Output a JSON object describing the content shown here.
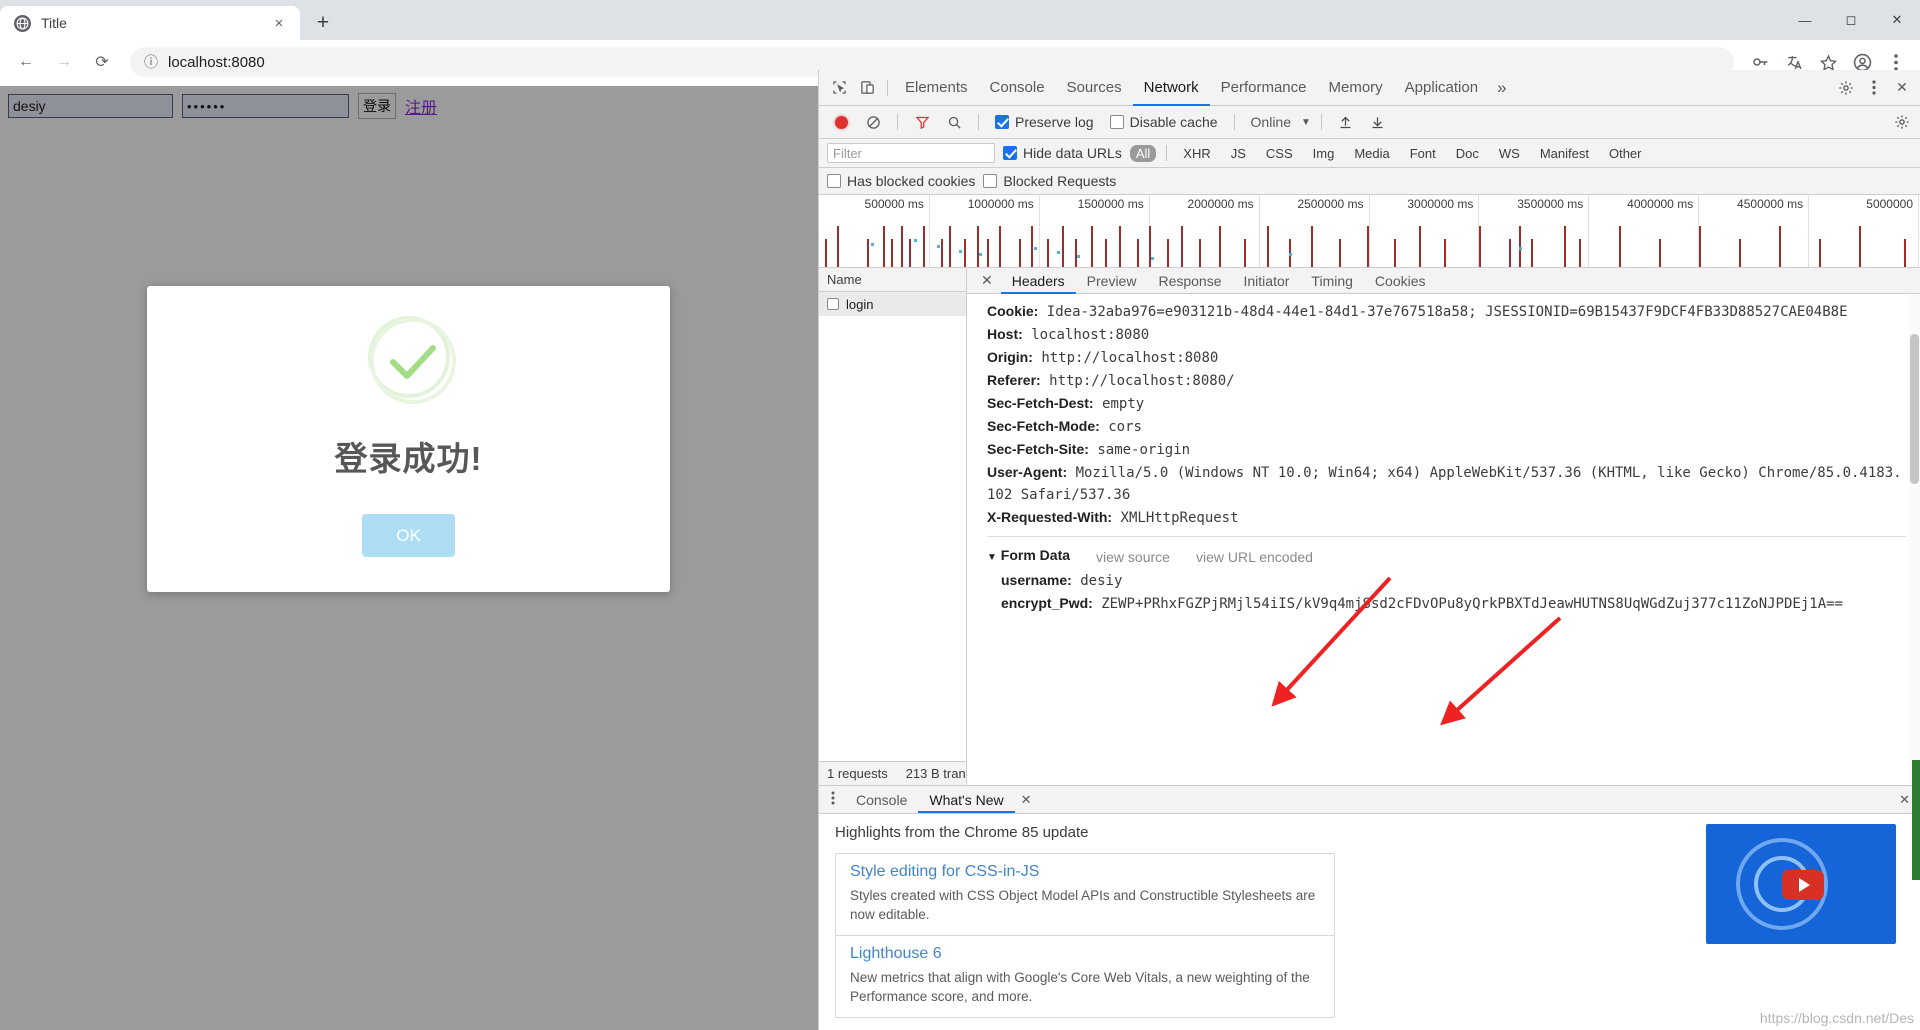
{
  "browser": {
    "tab": {
      "title": "Title",
      "favicon_icon": "globe-icon",
      "close_icon": "×"
    },
    "new_tab_label": "+",
    "window_controls": {
      "minimize": "—",
      "maximize": "◻",
      "close": "✕"
    },
    "nav": {
      "back": "←",
      "forward": "→",
      "reload": "⟳"
    },
    "omnibox": {
      "info_icon": "ⓘ",
      "url": "localhost:8080"
    },
    "toolbar_icons": [
      "key-icon",
      "translate-icon",
      "star-icon",
      "profile-icon",
      "menu-icon"
    ]
  },
  "page": {
    "form": {
      "username_value": "desiy",
      "username_placeholder": "",
      "password_value": "••••••",
      "login_button": "登录",
      "register_link": "注册"
    },
    "dialog": {
      "icon": "success-check-icon",
      "title": "登录成功!",
      "ok_button": "OK",
      "icon_color": "#a5dc86",
      "ok_color": "#aedef4"
    }
  },
  "devtools": {
    "inspect_icon": "cursor-inspect-icon",
    "device_icon": "device-toggle-icon",
    "tabs": [
      {
        "label": "Elements",
        "active": false
      },
      {
        "label": "Console",
        "active": false
      },
      {
        "label": "Sources",
        "active": false
      },
      {
        "label": "Network",
        "active": true
      },
      {
        "label": "Performance",
        "active": false
      },
      {
        "label": "Memory",
        "active": false
      },
      {
        "label": "Application",
        "active": false
      }
    ],
    "overflow_label": "»",
    "settings_icon": "gear-icon",
    "kebab_icon": "more-vertical-icon",
    "close_icon": "✕",
    "controls": {
      "record_icon": "record-dot-icon",
      "clear_icon": "clear-circle-icon",
      "filter_icon": "funnel-icon",
      "search_icon": "search-icon",
      "preserve_log": {
        "label": "Preserve log",
        "checked": true
      },
      "disable_cache": {
        "label": "Disable cache",
        "checked": false
      },
      "throttle": "Online",
      "throttle_caret": "▼",
      "import_icon": "upload-arrow-icon",
      "export_icon": "download-arrow-icon"
    },
    "filter": {
      "placeholder": "Filter",
      "hide_data_urls": {
        "label": "Hide data URLs",
        "checked": true
      },
      "types": [
        "All",
        "XHR",
        "JS",
        "CSS",
        "Img",
        "Media",
        "Font",
        "Doc",
        "WS",
        "Manifest",
        "Other"
      ],
      "active_type": "All"
    },
    "blocking": {
      "has_blocked_cookies": {
        "label": "Has blocked cookies",
        "checked": false
      },
      "blocked_requests": {
        "label": "Blocked Requests",
        "checked": false
      }
    },
    "overview": {
      "tick_labels": [
        "500000 ms",
        "1000000 ms",
        "1500000 ms",
        "2000000 ms",
        "2500000 ms",
        "3000000 ms",
        "3500000 ms",
        "4000000 ms",
        "4500000 ms",
        "5000000"
      ]
    },
    "requests": {
      "column_header": "Name",
      "rows": [
        {
          "name": "login",
          "selected": true
        }
      ],
      "footer": {
        "count": "1 requests",
        "transferred": "213 B trans"
      }
    },
    "detail": {
      "tabs": [
        {
          "label": "Headers",
          "active": true
        },
        {
          "label": "Preview",
          "active": false
        },
        {
          "label": "Response",
          "active": false
        },
        {
          "label": "Initiator",
          "active": false
        },
        {
          "label": "Timing",
          "active": false
        },
        {
          "label": "Cookies",
          "active": false
        }
      ],
      "headers": [
        {
          "name": "Cookie:",
          "value": "Idea-32aba976=e903121b-48d4-44e1-84d1-37e767518a58; JSESSIONID=69B15437F9DCF4FB33D88527CAE04B8E"
        },
        {
          "name": "Host:",
          "value": "localhost:8080"
        },
        {
          "name": "Origin:",
          "value": "http://localhost:8080"
        },
        {
          "name": "Referer:",
          "value": "http://localhost:8080/"
        },
        {
          "name": "Sec-Fetch-Dest:",
          "value": "empty"
        },
        {
          "name": "Sec-Fetch-Mode:",
          "value": "cors"
        },
        {
          "name": "Sec-Fetch-Site:",
          "value": "same-origin"
        },
        {
          "name": "User-Agent:",
          "value": "Mozilla/5.0 (Windows NT 10.0; Win64; x64) AppleWebKit/537.36 (KHTML, like Gecko) Chrome/85.0.4183.102 Safari/537.36"
        },
        {
          "name": "X-Requested-With:",
          "value": "XMLHttpRequest"
        }
      ],
      "form_data": {
        "caret": "▼",
        "title": "Form Data",
        "view_source": "view source",
        "view_url_encoded": "view URL encoded",
        "fields": [
          {
            "name": "username:",
            "value": "desiy"
          },
          {
            "name": "encrypt_Pwd:",
            "value": "ZEWP+PRhxFGZPjRMjl54iIS/kV9q4mjSsd2cFDvOPu8yQrkPBXTdJeawHUTNS8UqWGdZuj377c11ZoNJPDEj1A=="
          }
        ]
      }
    },
    "drawer": {
      "tabs": [
        {
          "label": "Console",
          "active": false
        },
        {
          "label": "What's New",
          "active": true
        }
      ],
      "close_icon": "✕",
      "heading": "Highlights from the Chrome 85 update",
      "cards": [
        {
          "title": "Style editing for CSS-in-JS",
          "desc": "Styles created with CSS Object Model APIs and Constructible Stylesheets are now editable."
        },
        {
          "title": "Lighthouse 6",
          "desc": "New metrics that align with Google's Core Web Vitals, a new weighting of the Performance score, and more."
        }
      ],
      "video_play_icon": "play-icon"
    }
  },
  "watermark": "https://blog.csdn.net/Des"
}
